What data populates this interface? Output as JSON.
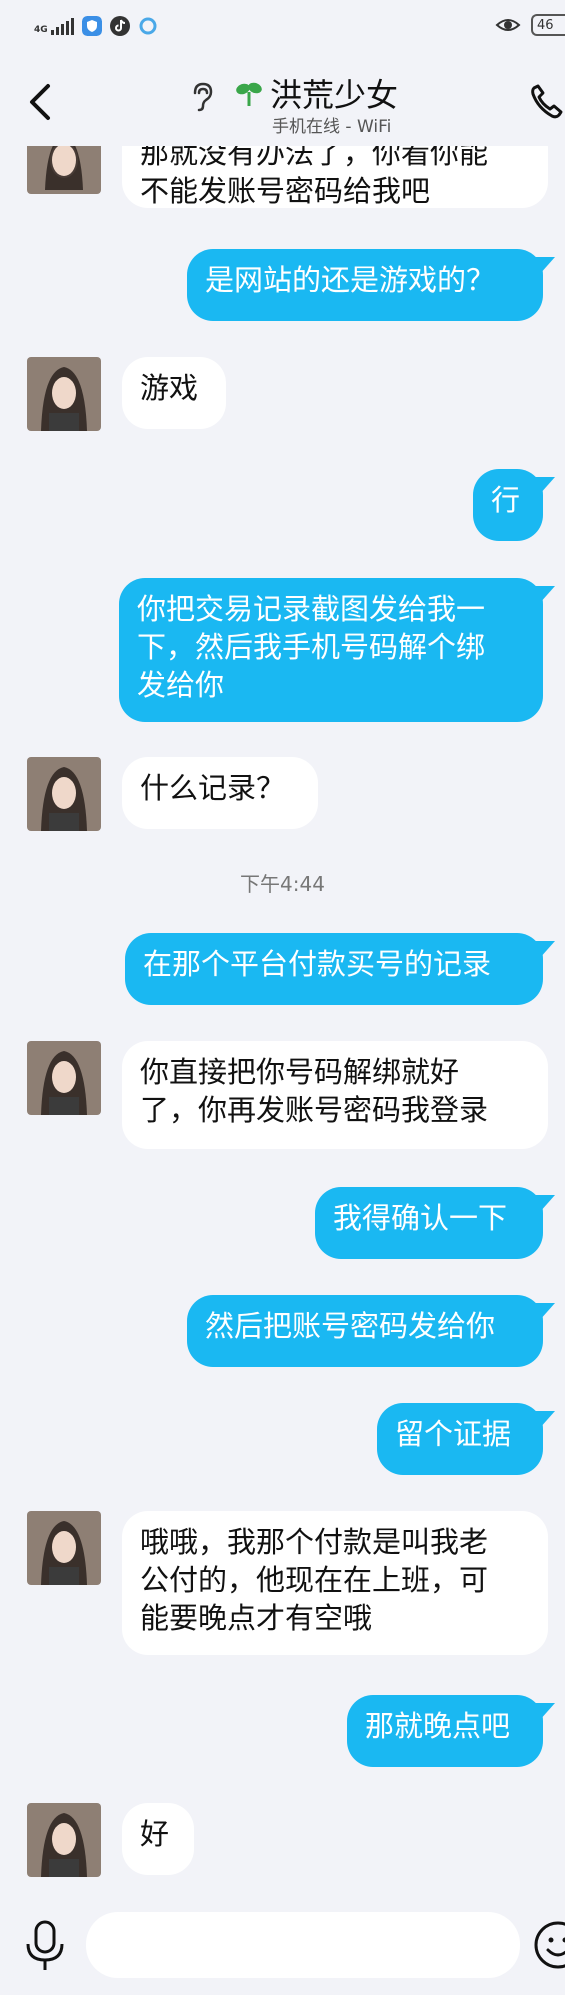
{
  "statusbar": {
    "network": "4G",
    "battery": "46"
  },
  "header": {
    "title": "洪荒少女",
    "subtitle": "手机在线 - WiFi"
  },
  "chat": {
    "messages": [
      {
        "dir": "in",
        "text": "那就没有办法了，你看你能\n不能发账号密码给我吧",
        "partial": true
      },
      {
        "dir": "out",
        "text": "是网站的还是游戏的？"
      },
      {
        "dir": "in",
        "text": "游戏"
      },
      {
        "dir": "out",
        "text": "行"
      },
      {
        "dir": "out",
        "text": "你把交易记录截图发给我一\n下，然后我手机号码解个绑\n发给你"
      },
      {
        "dir": "in",
        "text": "什么记录？"
      },
      {
        "dir": "out",
        "text": "在那个平台付款买号的记录"
      },
      {
        "dir": "in",
        "text": "你直接把你号码解绑就好\n了，你再发账号密码我登录"
      },
      {
        "dir": "out",
        "text": "我得确认一下"
      },
      {
        "dir": "out",
        "text": "然后把账号密码发给你"
      },
      {
        "dir": "out",
        "text": "留个证据"
      },
      {
        "dir": "in",
        "text": "哦哦，我那个付款是叫我老\n公付的，他现在在上班，可\n能要晚点才有空哦"
      },
      {
        "dir": "out",
        "text": "那就晚点吧"
      },
      {
        "dir": "in",
        "text": "好"
      }
    ],
    "timestamp": "下午4:44"
  },
  "input": {
    "placeholder": ""
  },
  "colors": {
    "background": "#f2f3f8",
    "outgoing_bubble": "#1ab8f2",
    "incoming_bubble": "#ffffff",
    "sprout": "#3aa64a"
  }
}
